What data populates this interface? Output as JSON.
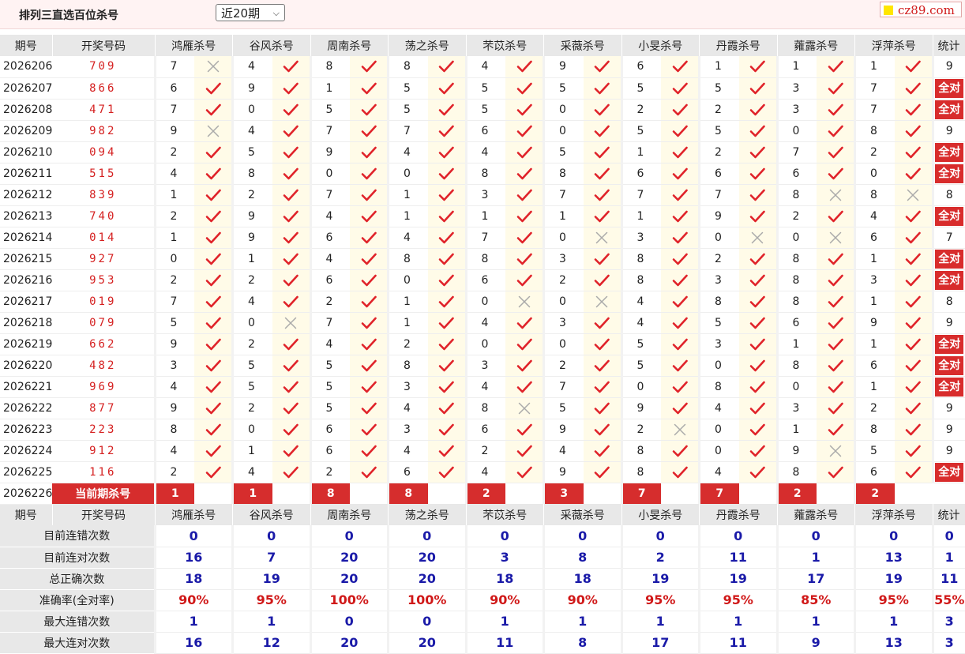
{
  "header": {
    "title": "排列三直选百位杀号",
    "select_value": "近20期",
    "logo": "cz89.com"
  },
  "columns": {
    "issue": "期号",
    "draw": "开奖号码",
    "stat": "统计",
    "experts": [
      "鸿雁杀号",
      "谷风杀号",
      "周南杀号",
      "荡之杀号",
      "芣苡杀号",
      "采薇杀号",
      "小旻杀号",
      "丹霞杀号",
      "蕹露杀号",
      "浮萍杀号"
    ]
  },
  "all_correct_label": "全对",
  "rows": [
    {
      "issue": "2026206",
      "draw": "709",
      "kills": [
        7,
        4,
        8,
        8,
        4,
        9,
        6,
        1,
        1,
        1
      ],
      "ok": [
        0,
        1,
        1,
        1,
        1,
        1,
        1,
        1,
        1,
        1
      ],
      "stat": "9"
    },
    {
      "issue": "2026207",
      "draw": "866",
      "kills": [
        6,
        9,
        1,
        5,
        5,
        5,
        5,
        5,
        3,
        7
      ],
      "ok": [
        1,
        1,
        1,
        1,
        1,
        1,
        1,
        1,
        1,
        1
      ],
      "stat": "全对"
    },
    {
      "issue": "2026208",
      "draw": "471",
      "kills": [
        7,
        0,
        5,
        5,
        5,
        0,
        2,
        2,
        3,
        7
      ],
      "ok": [
        1,
        1,
        1,
        1,
        1,
        1,
        1,
        1,
        1,
        1
      ],
      "stat": "全对"
    },
    {
      "issue": "2026209",
      "draw": "982",
      "kills": [
        9,
        4,
        7,
        7,
        6,
        0,
        5,
        5,
        0,
        8
      ],
      "ok": [
        0,
        1,
        1,
        1,
        1,
        1,
        1,
        1,
        1,
        1
      ],
      "stat": "9"
    },
    {
      "issue": "2026210",
      "draw": "094",
      "kills": [
        2,
        5,
        9,
        4,
        4,
        5,
        1,
        2,
        7,
        2
      ],
      "ok": [
        1,
        1,
        1,
        1,
        1,
        1,
        1,
        1,
        1,
        1
      ],
      "stat": "全对"
    },
    {
      "issue": "2026211",
      "draw": "515",
      "kills": [
        4,
        8,
        0,
        0,
        8,
        8,
        6,
        6,
        6,
        0
      ],
      "ok": [
        1,
        1,
        1,
        1,
        1,
        1,
        1,
        1,
        1,
        1
      ],
      "stat": "全对"
    },
    {
      "issue": "2026212",
      "draw": "839",
      "kills": [
        1,
        2,
        7,
        1,
        3,
        7,
        7,
        7,
        8,
        8
      ],
      "ok": [
        1,
        1,
        1,
        1,
        1,
        1,
        1,
        1,
        0,
        0
      ],
      "stat": "8"
    },
    {
      "issue": "2026213",
      "draw": "740",
      "kills": [
        2,
        9,
        4,
        1,
        1,
        1,
        1,
        9,
        2,
        4
      ],
      "ok": [
        1,
        1,
        1,
        1,
        1,
        1,
        1,
        1,
        1,
        1
      ],
      "stat": "全对"
    },
    {
      "issue": "2026214",
      "draw": "014",
      "kills": [
        1,
        9,
        6,
        4,
        7,
        0,
        3,
        0,
        0,
        6
      ],
      "ok": [
        1,
        1,
        1,
        1,
        1,
        0,
        1,
        0,
        0,
        1
      ],
      "stat": "7"
    },
    {
      "issue": "2026215",
      "draw": "927",
      "kills": [
        0,
        1,
        4,
        8,
        8,
        3,
        8,
        2,
        8,
        1
      ],
      "ok": [
        1,
        1,
        1,
        1,
        1,
        1,
        1,
        1,
        1,
        1
      ],
      "stat": "全对"
    },
    {
      "issue": "2026216",
      "draw": "953",
      "kills": [
        2,
        2,
        6,
        0,
        6,
        2,
        8,
        3,
        8,
        3
      ],
      "ok": [
        1,
        1,
        1,
        1,
        1,
        1,
        1,
        1,
        1,
        1
      ],
      "stat": "全对"
    },
    {
      "issue": "2026217",
      "draw": "019",
      "kills": [
        7,
        4,
        2,
        1,
        0,
        0,
        4,
        8,
        8,
        1
      ],
      "ok": [
        1,
        1,
        1,
        1,
        0,
        0,
        1,
        1,
        1,
        1
      ],
      "stat": "8"
    },
    {
      "issue": "2026218",
      "draw": "079",
      "kills": [
        5,
        0,
        7,
        1,
        4,
        3,
        4,
        5,
        6,
        9
      ],
      "ok": [
        1,
        0,
        1,
        1,
        1,
        1,
        1,
        1,
        1,
        1
      ],
      "stat": "9"
    },
    {
      "issue": "2026219",
      "draw": "662",
      "kills": [
        9,
        2,
        4,
        2,
        0,
        0,
        5,
        3,
        1,
        1
      ],
      "ok": [
        1,
        1,
        1,
        1,
        1,
        1,
        1,
        1,
        1,
        1
      ],
      "stat": "全对"
    },
    {
      "issue": "2026220",
      "draw": "482",
      "kills": [
        3,
        5,
        5,
        8,
        3,
        2,
        5,
        0,
        8,
        6
      ],
      "ok": [
        1,
        1,
        1,
        1,
        1,
        1,
        1,
        1,
        1,
        1
      ],
      "stat": "全对"
    },
    {
      "issue": "2026221",
      "draw": "969",
      "kills": [
        4,
        5,
        5,
        3,
        4,
        7,
        0,
        8,
        0,
        1
      ],
      "ok": [
        1,
        1,
        1,
        1,
        1,
        1,
        1,
        1,
        1,
        1
      ],
      "stat": "全对"
    },
    {
      "issue": "2026222",
      "draw": "877",
      "kills": [
        9,
        2,
        5,
        4,
        8,
        5,
        9,
        4,
        3,
        2
      ],
      "ok": [
        1,
        1,
        1,
        1,
        0,
        1,
        1,
        1,
        1,
        1
      ],
      "stat": "9"
    },
    {
      "issue": "2026223",
      "draw": "223",
      "kills": [
        8,
        0,
        6,
        3,
        6,
        9,
        2,
        0,
        1,
        8
      ],
      "ok": [
        1,
        1,
        1,
        1,
        1,
        1,
        0,
        1,
        1,
        1
      ],
      "stat": "9"
    },
    {
      "issue": "2026224",
      "draw": "912",
      "kills": [
        4,
        1,
        6,
        4,
        2,
        4,
        8,
        0,
        9,
        5
      ],
      "ok": [
        1,
        1,
        1,
        1,
        1,
        1,
        1,
        1,
        0,
        1
      ],
      "stat": "9"
    },
    {
      "issue": "2026225",
      "draw": "116",
      "kills": [
        2,
        4,
        2,
        6,
        4,
        9,
        8,
        4,
        8,
        6
      ],
      "ok": [
        1,
        1,
        1,
        1,
        1,
        1,
        1,
        1,
        1,
        1
      ],
      "stat": "全对"
    }
  ],
  "current": {
    "issue": "2026226",
    "label": "当前期杀号",
    "kills": [
      1,
      1,
      8,
      8,
      2,
      3,
      7,
      7,
      2,
      2
    ]
  },
  "stats": [
    {
      "label": "目前连错次数",
      "values": [
        "0",
        "0",
        "0",
        "0",
        "0",
        "0",
        "0",
        "0",
        "0",
        "0",
        "0"
      ]
    },
    {
      "label": "目前连对次数",
      "values": [
        "16",
        "7",
        "20",
        "20",
        "3",
        "8",
        "2",
        "11",
        "1",
        "13",
        "1"
      ]
    },
    {
      "label": "总正确次数",
      "values": [
        "18",
        "19",
        "20",
        "20",
        "18",
        "18",
        "19",
        "19",
        "17",
        "19",
        "11"
      ]
    },
    {
      "label": "准确率(全对率)",
      "values": [
        "90%",
        "95%",
        "100%",
        "100%",
        "90%",
        "90%",
        "95%",
        "95%",
        "85%",
        "95%",
        "55%"
      ],
      "rate": true
    },
    {
      "label": "最大连错次数",
      "values": [
        "1",
        "1",
        "0",
        "0",
        "1",
        "1",
        "1",
        "1",
        "1",
        "1",
        "3"
      ]
    },
    {
      "label": "最大连对次数",
      "values": [
        "16",
        "12",
        "20",
        "20",
        "11",
        "8",
        "17",
        "11",
        "9",
        "13",
        "3"
      ]
    }
  ],
  "colors": {
    "red": "#d82c2c",
    "blue": "#1a1aa8",
    "mark_bg": "#fffbe8",
    "header_bg": "#e8e8e8"
  }
}
